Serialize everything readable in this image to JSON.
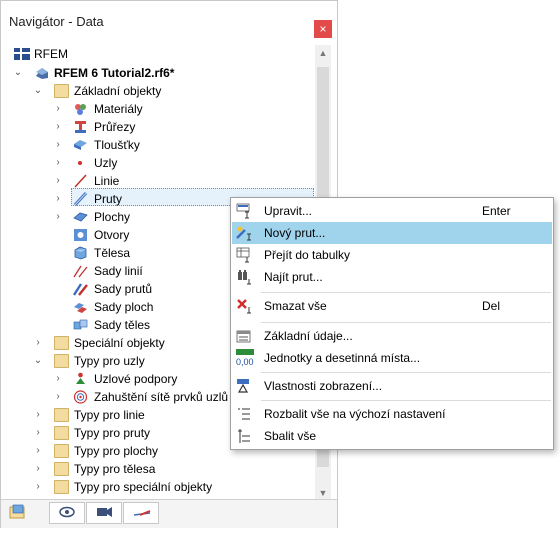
{
  "window": {
    "title": "Navigátor - Data",
    "close_label": "×"
  },
  "tree": {
    "root": "RFEM",
    "file": "RFEM 6 Tutorial2.rf6*",
    "basic": "Základní objekty",
    "items": {
      "materials": "Materiály",
      "sections": "Průřezy",
      "thickness": "Tloušťky",
      "nodes": "Uzly",
      "lines": "Linie",
      "members": "Pruty",
      "surfaces": "Plochy",
      "openings": "Otvory",
      "solids": "Tělesa",
      "line_sets": "Sady linií",
      "member_sets": "Sady prutů",
      "surface_sets": "Sady ploch",
      "solid_sets": "Sady těles"
    },
    "special": "Speciální objekty",
    "node_types": "Typy pro uzly",
    "nodal_supports": "Uzlové podpory",
    "mesh_refinement": "Zahuštění sítě prvků uzlů",
    "line_types": "Typy pro linie",
    "member_types": "Typy pro pruty",
    "surface_types": "Typy pro plochy",
    "solid_types": "Typy pro tělesa",
    "special_types": "Typy pro speciální objekty"
  },
  "menu": {
    "edit": "Upravit...",
    "edit_shortcut": "Enter",
    "new_member": "Nový prut...",
    "goto_table": "Přejít do tabulky",
    "find_member": "Najít prut...",
    "delete_all": "Smazat vše",
    "delete_shortcut": "Del",
    "basic_data": "Základní údaje...",
    "units": "Jednotky a desetinná místa...",
    "display_props": "Vlastnosti zobrazení...",
    "expand_default": "Rozbalit vše na výchozí nastavení",
    "collapse_all": "Sbalit vše"
  },
  "units_icon_text": "0,00"
}
